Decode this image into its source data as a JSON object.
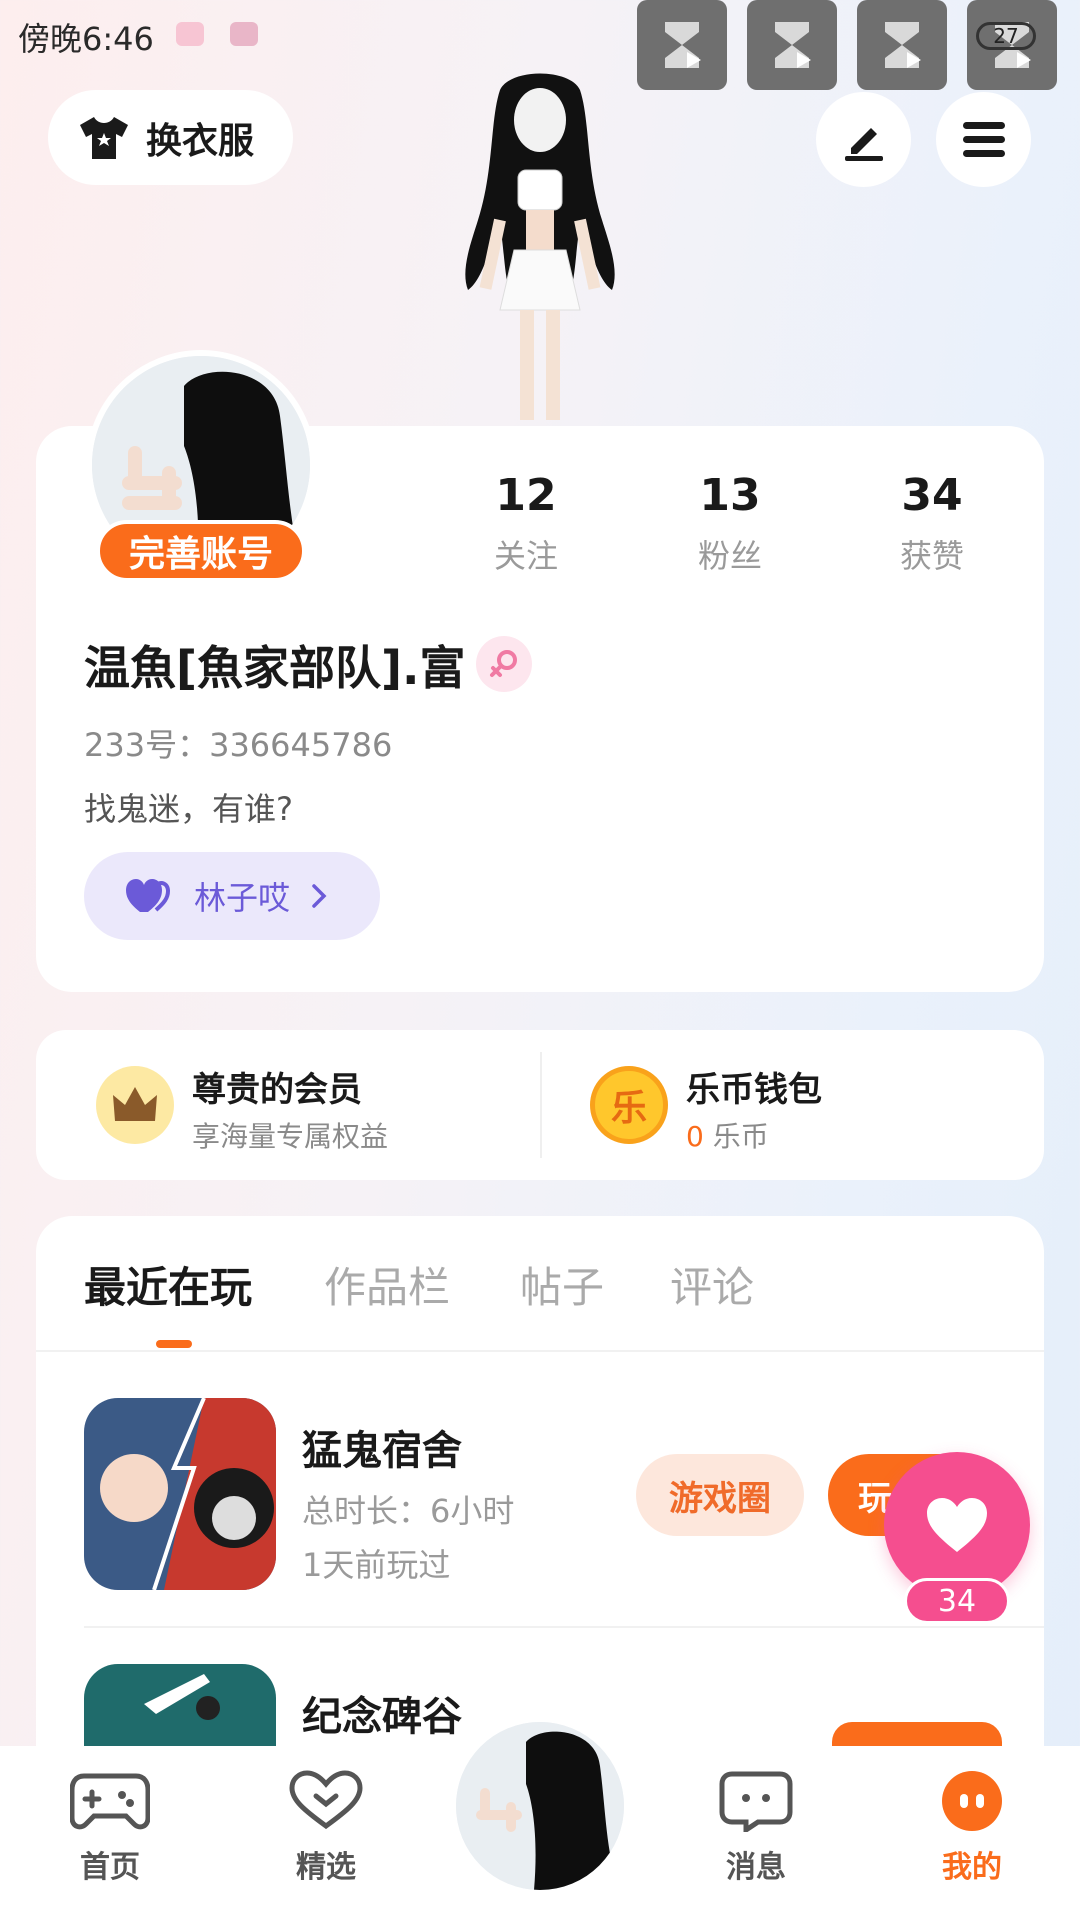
{
  "status_bar": {
    "time": "傍晚6:46",
    "battery": "27"
  },
  "header": {
    "change_outfit": "换衣服"
  },
  "profile": {
    "finish_account": "完善账号",
    "stats": [
      {
        "value": "12",
        "label": "关注"
      },
      {
        "value": "13",
        "label": "粉丝"
      },
      {
        "value": "34",
        "label": "获赞"
      }
    ],
    "name": "温魚[魚家部队].富",
    "uid": "233号：336645786",
    "bio": "找鬼迷，有谁?",
    "cp_name": "林子哎"
  },
  "member": {
    "title": "尊贵的会员",
    "subtitle": "享海量专属权益"
  },
  "wallet": {
    "title": "乐币钱包",
    "coin_char": "乐",
    "amount": "0",
    "unit": "乐币"
  },
  "tabs": [
    "最近在玩",
    "作品栏",
    "帖子",
    "评论"
  ],
  "games": [
    {
      "title": "猛鬼宿舍",
      "duration": "总时长：6小时",
      "last_played": "1天前玩过",
      "circle_label": "游戏圈",
      "play_label": "玩"
    },
    {
      "title": "纪念碑谷"
    }
  ],
  "like_fab": {
    "count": "34"
  },
  "bottom_nav": [
    {
      "label": "首页"
    },
    {
      "label": "精选"
    },
    {
      "label": "消息"
    },
    {
      "label": "我的"
    }
  ],
  "colors": {
    "accent": "#fa6c1b",
    "like_pink": "#f54e8f",
    "cp_purple": "#6b5ad8"
  }
}
